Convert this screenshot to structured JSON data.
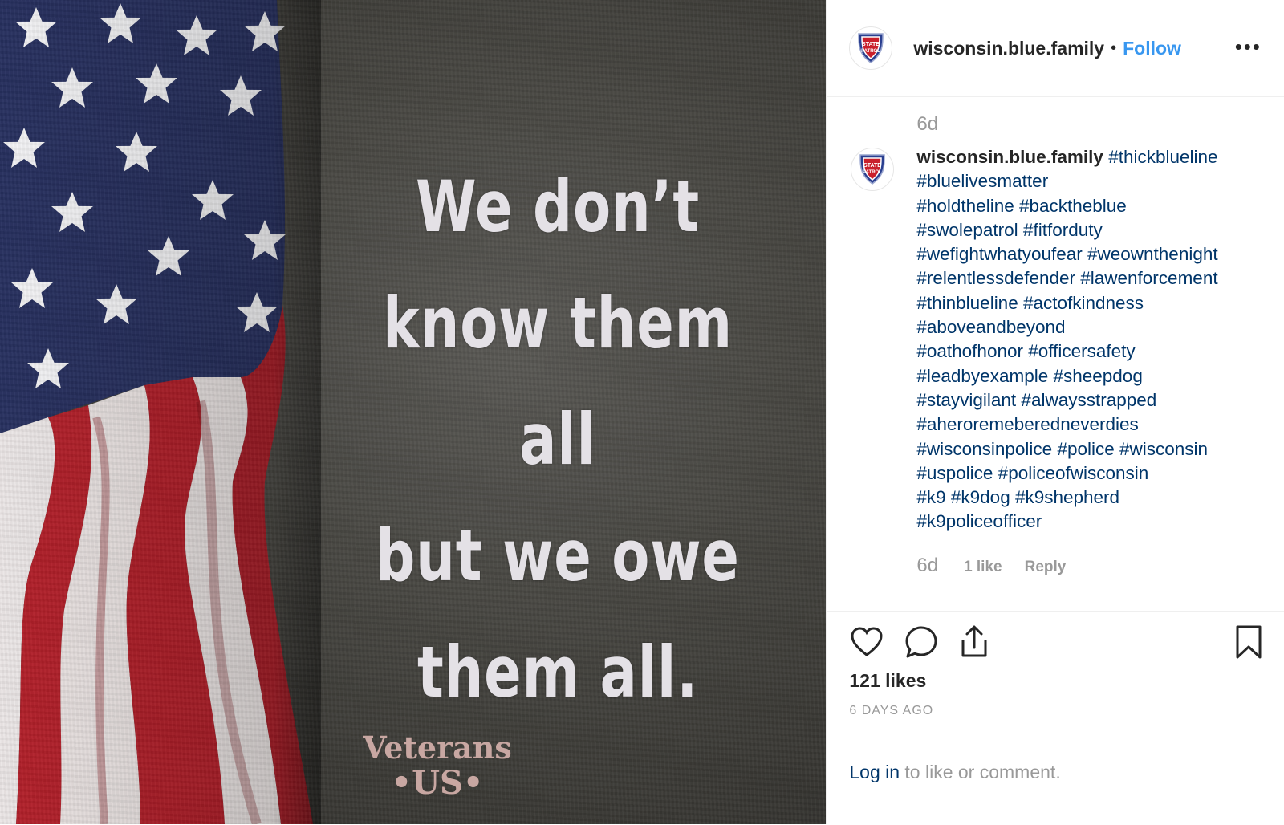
{
  "media": {
    "quote_lines": [
      "We don’t",
      "know them all",
      "but we owe",
      "them all."
    ],
    "brand_line1": "Veterans",
    "brand_line2": "•US•"
  },
  "header": {
    "avatar_text": "STATE PATROL",
    "username": "wisconsin.blue.family",
    "separator": "•",
    "follow_label": "Follow",
    "more_label": "•••"
  },
  "comments": {
    "top_time": "6d",
    "caption_username": "wisconsin.blue.family",
    "caption_tags": "#thickblueline #bluelivesmatter #holdtheline #backtheblue #swolepatrol #fitforduty #wefightwhatyoufear #weownthenight #relentlessdefender #lawenforcement #thinblueline #actofkindness #aboveandbeyond #oathofhonor #officersafety #leadbyexample #sheepdog #stayvigilant #alwaysstrapped #aheroremberedneverdies #wisconsinpolice #police #wisconsin #uspolice #policeofwisconsin #k9 #k9dog #k9shepherd #k9policeofficer",
    "caption_lines": [
      "#bluelivesmatter",
      "#holdtheline #backtheblue",
      "#swolepatrol #fitforduty",
      "#wefightwhatyoufear #weownthenight",
      "#relentlessdefender #lawenforcement",
      "#thinblueline #actofkindness",
      "#aboveandbeyond",
      "#oathofhonor #officersafety",
      "#leadbyexample #sheepdog",
      "#stayvigilant #alwaysstrapped",
      "#aheroremeberedneverdies",
      "#wisconsinpolice #police #wisconsin",
      "#uspolice #policeofwisconsin",
      "#k9 #k9dog #k9shepherd",
      "#k9policeofficer"
    ],
    "first_tag": "#thickblueline",
    "meta_time": "6d",
    "meta_likes": "1 like",
    "reply_label": "Reply"
  },
  "actions": {
    "icons": [
      "heart-icon",
      "comment-icon",
      "share-icon",
      "bookmark-icon"
    ]
  },
  "likes_text": "121 likes",
  "ago_text": "6 DAYS AGO",
  "login": {
    "link": "Log in",
    "rest": " to like or comment."
  },
  "colors": {
    "follow_blue": "#3897f0",
    "hashtag_navy": "#003569",
    "muted_gray": "#999999"
  }
}
